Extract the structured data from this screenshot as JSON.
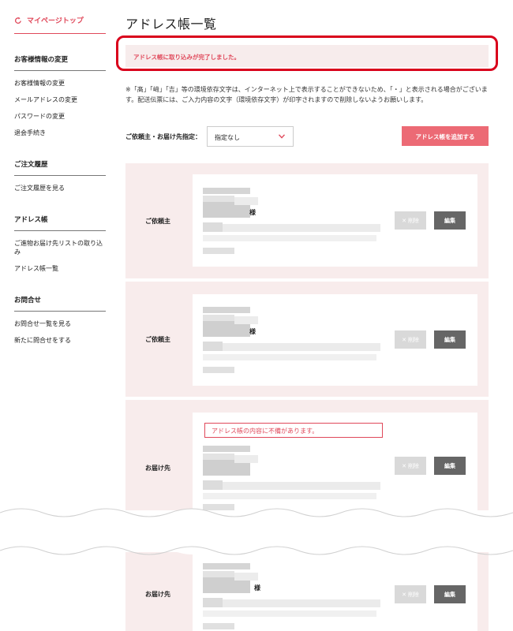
{
  "sidebar": {
    "top_link": "マイページトップ",
    "sections": [
      {
        "heading": "お客様情報の変更",
        "items": [
          "お客様情報の変更",
          "メールアドレスの変更",
          "パスワードの変更",
          "退会手続き"
        ]
      },
      {
        "heading": "ご注文履歴",
        "items": [
          "ご注文履歴を見る"
        ]
      },
      {
        "heading": "アドレス帳",
        "items": [
          "ご進物お届け先リストの取り込み",
          "アドレス帳一覧"
        ]
      },
      {
        "heading": "お問合せ",
        "items": [
          "お問合せ一覧を見る",
          "新たに問合せをする"
        ]
      }
    ]
  },
  "main": {
    "title": "アドレス帳一覧",
    "alert": "アドレス帳に取り込みが完了しました。",
    "notice": "※「髙」「﨑」「吉」等の環境依存文字は、インターネット上で表示することができないため、「・」と表示される場合がございます。配送伝票には、ご入力内容の文字（環境依存文字）が印字されますので削除しないようお願いします。",
    "filter": {
      "label": "ご依頼主・お届け先指定：",
      "value": "指定なし"
    },
    "add_button": "アドレス帳を追加する",
    "delete_label": "削除",
    "edit_label": "編集",
    "honorific": "様",
    "cards": [
      {
        "type": "ご依頼主"
      },
      {
        "type": "ご依頼主"
      },
      {
        "type": "お届け先",
        "error": "アドレス帳の内容に不備があります。"
      },
      {
        "type": "お届け先"
      }
    ]
  },
  "colors": {
    "accent": "#e0485a",
    "button_pink": "#ec6a75",
    "card_bg": "#f8ecec",
    "highlight": "#d9001b"
  }
}
